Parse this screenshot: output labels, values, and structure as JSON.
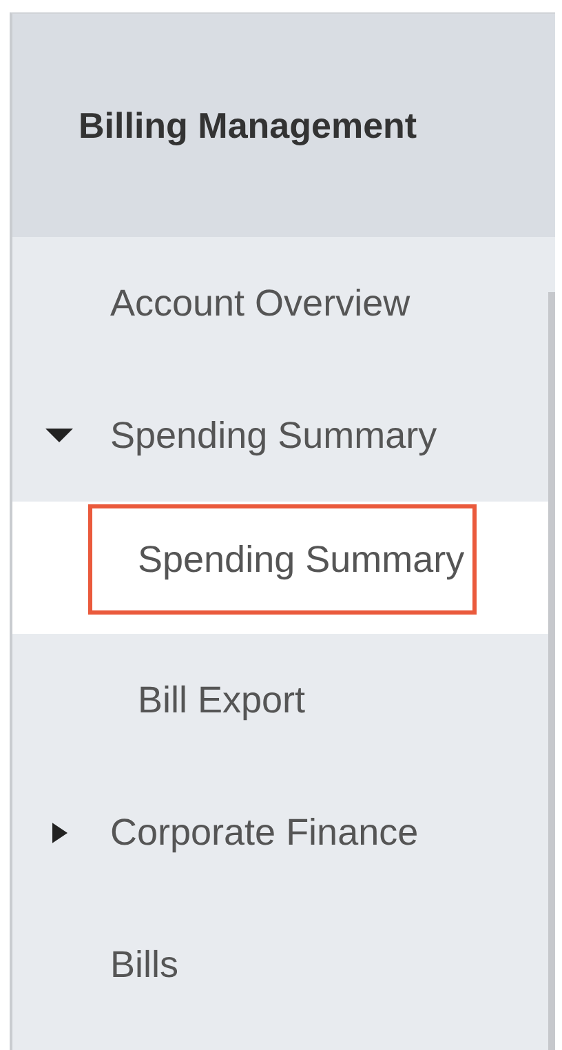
{
  "sidebar": {
    "title": "Billing Management",
    "items": [
      {
        "label": "Account Overview",
        "selected": false
      },
      {
        "label": "Spending Summary",
        "selected": false,
        "expanded": true,
        "children": [
          {
            "label": "Spending Summary",
            "selected": true,
            "highlighted": true
          },
          {
            "label": "Bill Export",
            "selected": false
          }
        ]
      },
      {
        "label": "Corporate Finance",
        "selected": false,
        "expanded": false
      },
      {
        "label": "Bills",
        "selected": false
      }
    ]
  }
}
